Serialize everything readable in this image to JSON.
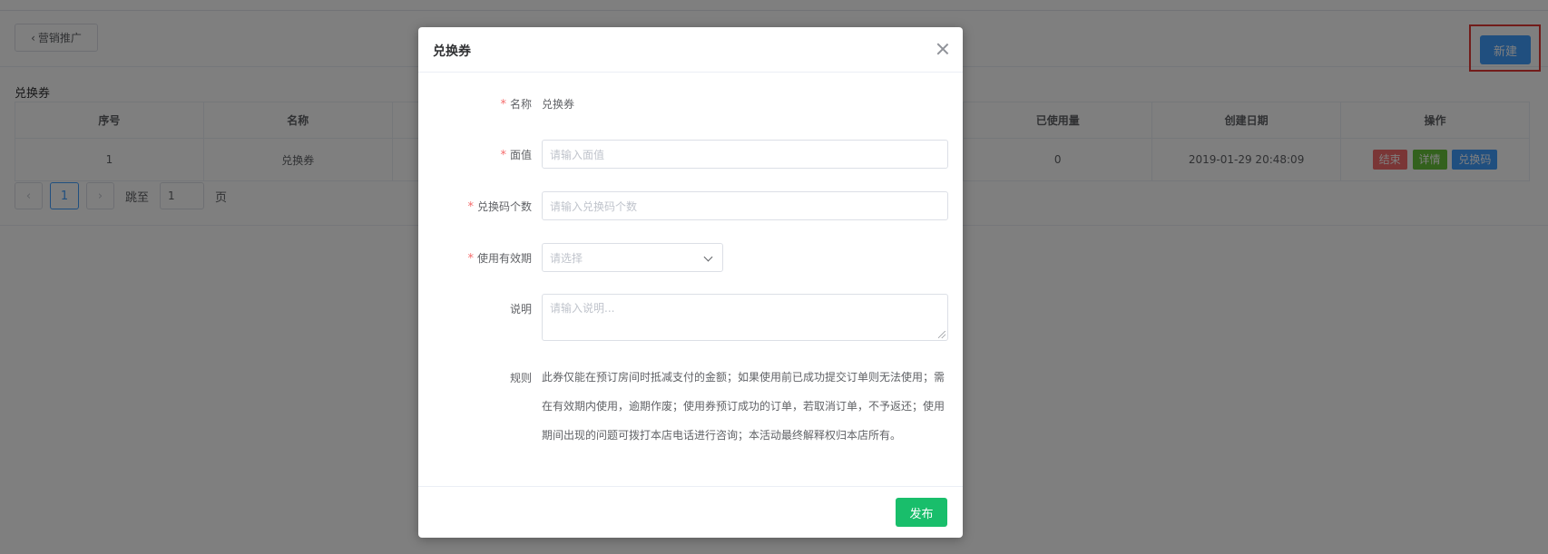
{
  "header": {
    "back_label": "营销推广",
    "new_label": "新建"
  },
  "section": {
    "title": "兑换券"
  },
  "table": {
    "columns": [
      "序号",
      "名称",
      "已使用量",
      "创建日期",
      "操作"
    ],
    "rows": [
      {
        "index": "1",
        "name": "兑换券",
        "used": "0",
        "created": "2019-01-29 20:48:09",
        "actions": [
          "结束",
          "详情",
          "兑换码"
        ]
      }
    ]
  },
  "pagination": {
    "current_page": "1",
    "jump_label": "跳至",
    "jump_value": "1",
    "page_suffix": "页"
  },
  "modal": {
    "title": "兑换券",
    "fields": {
      "name": {
        "label": "名称",
        "value": "兑换券"
      },
      "face_value": {
        "label": "面值",
        "placeholder": "请输入面值"
      },
      "code_count": {
        "label": "兑换码个数",
        "placeholder": "请输入兑换码个数"
      },
      "validity": {
        "label": "使用有效期",
        "placeholder": "请选择"
      },
      "description": {
        "label": "说明",
        "placeholder": "请输入说明..."
      },
      "rules": {
        "label": "规则",
        "text": "此券仅能在预订房间时抵减支付的金额；如果使用前已成功提交订单则无法使用；需在有效期内使用，逾期作废；使用券预订成功的订单，若取消订单，不予返还；使用期间出现的问题可拨打本店电话进行咨询；本活动最终解释权归本店所有。"
      }
    },
    "publish_label": "发布"
  }
}
